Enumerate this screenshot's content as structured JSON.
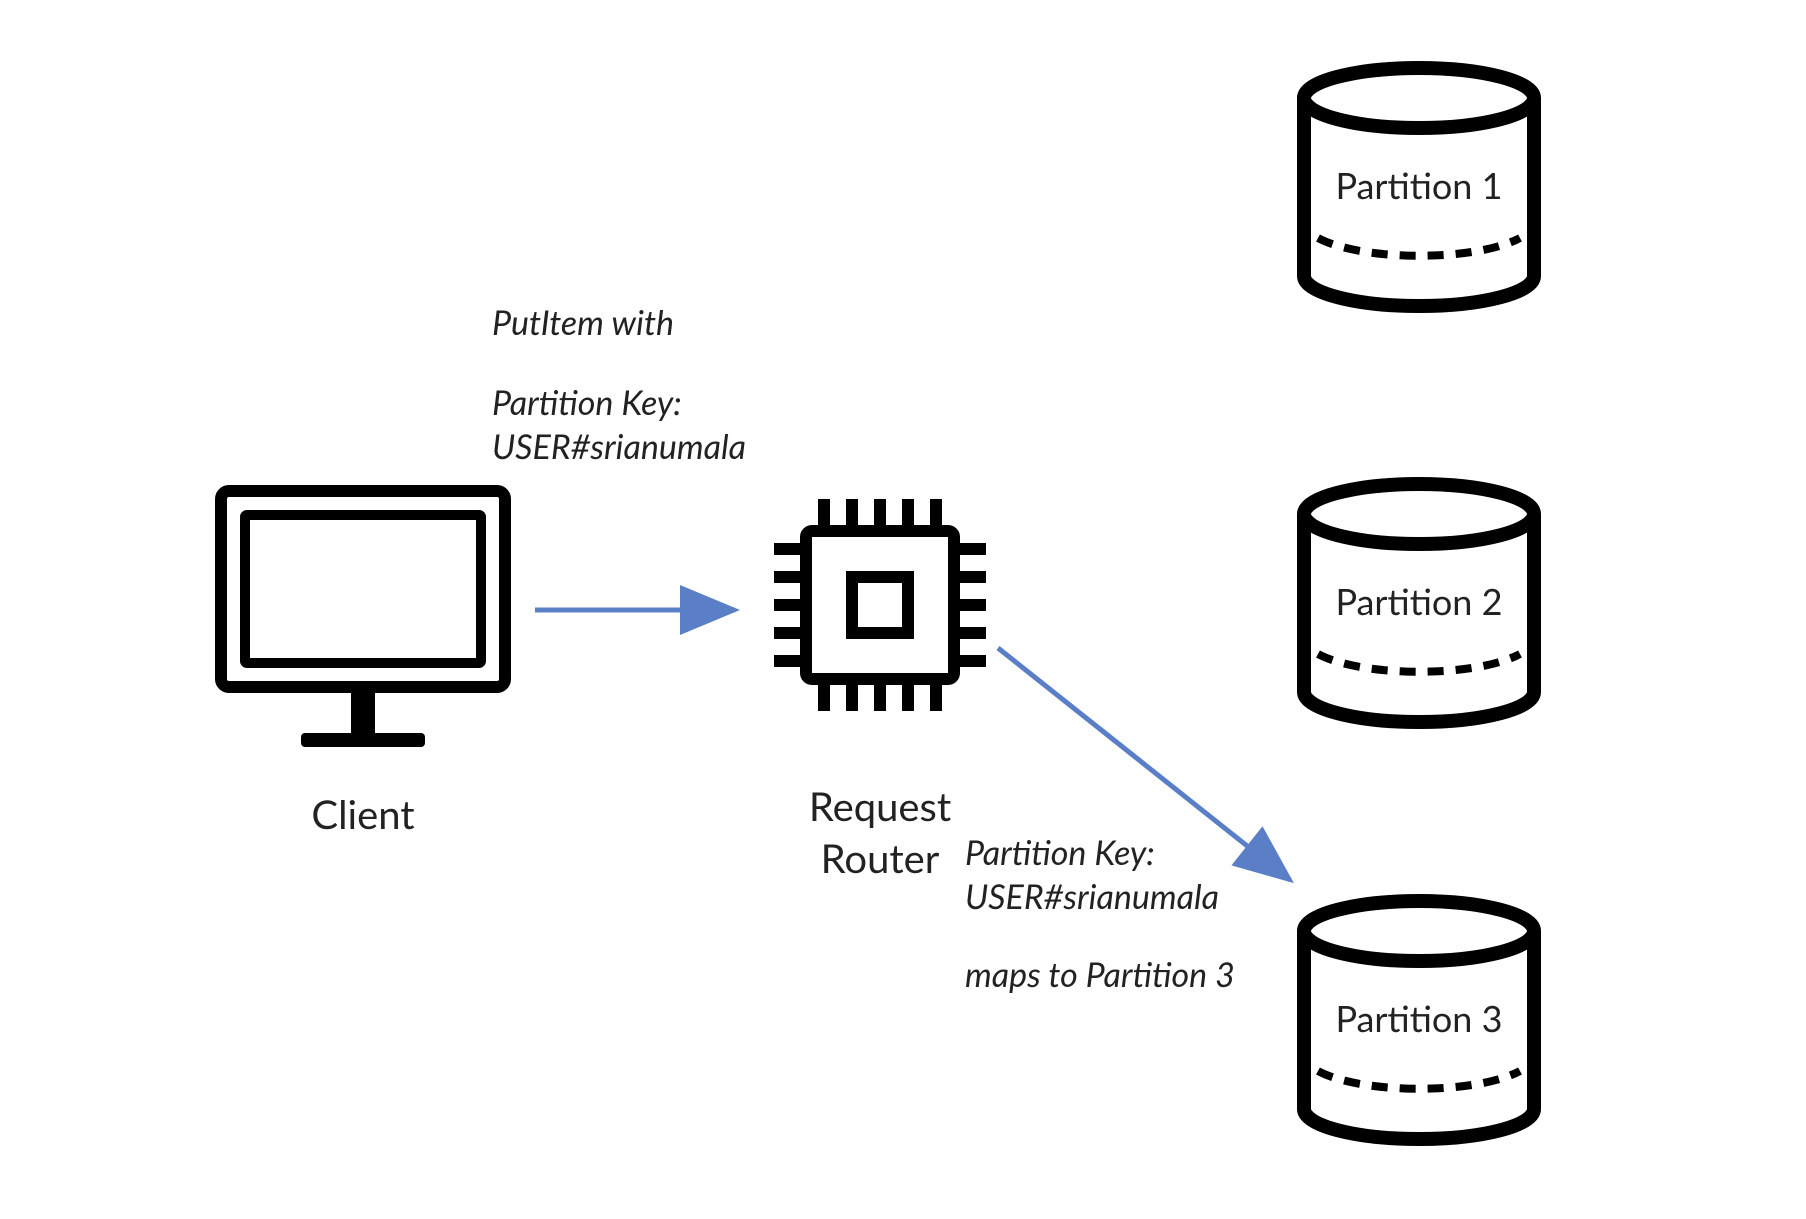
{
  "nodes": {
    "client": {
      "label": "Client"
    },
    "router": {
      "label_line1": "Request",
      "label_line2": "Router"
    },
    "partition1": {
      "label": "Partition 1"
    },
    "partition2": {
      "label": "Partition 2"
    },
    "partition3": {
      "label": "Partition 3"
    }
  },
  "annotations": {
    "request": {
      "line1": "PutItem with",
      "line2": "Partition Key:",
      "line3": "USER#srianumala"
    },
    "route": {
      "line1": "Partition Key:",
      "line2": "USER#srianumala",
      "line3": "maps to Partition 3"
    }
  },
  "colors": {
    "stroke": "#000000",
    "arrow": "#5B7FC7"
  }
}
